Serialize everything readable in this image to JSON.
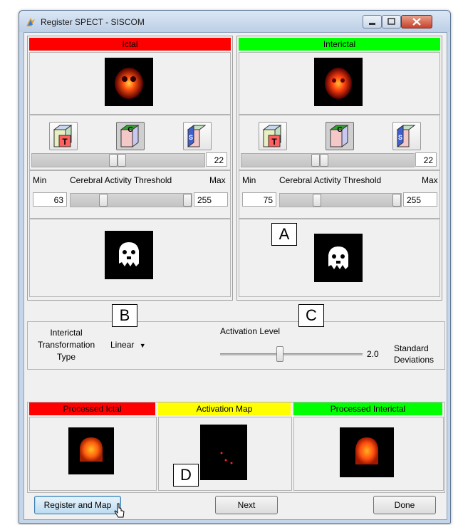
{
  "window": {
    "title": "Register SPECT - SISCOM"
  },
  "ictal_panel": {
    "header": "Ictal",
    "header_color": "#ff0000",
    "slice_value": "22",
    "threshold": {
      "min_label": "Min",
      "title": "Cerebral Activity Threshold",
      "max_label": "Max",
      "min_value": "63",
      "max_value": "255"
    }
  },
  "interictal_panel": {
    "header": "Interictal",
    "header_color": "#00ff00",
    "slice_value": "22",
    "threshold": {
      "min_label": "Min",
      "title": "Cerebral Activity Threshold",
      "max_label": "Max",
      "min_value": "75",
      "max_value": "255"
    }
  },
  "view_buttons": [
    {
      "label": "T",
      "icon": "transverse-cube-icon"
    },
    {
      "label": "C",
      "icon": "coronal-cube-icon",
      "active": true
    },
    {
      "label": "S",
      "icon": "sagittal-cube-icon"
    }
  ],
  "settings": {
    "transformation_label_line1": "Interictal",
    "transformation_label_line2": "Transformation",
    "transformation_label_line3": "Type",
    "transformation_value": "Linear",
    "activation_label": "Activation Level",
    "activation_value": "2.0",
    "units_line1": "Standard",
    "units_line2": "Deviations",
    "activation_fraction": 0.42
  },
  "results": {
    "processed_ictal": {
      "label": "Processed Ictal",
      "color": "#ff0000"
    },
    "activation_map": {
      "label": "Activation Map",
      "color": "#ffff00"
    },
    "processed_interictal": {
      "label": "Processed Interictal",
      "color": "#00ff00"
    }
  },
  "buttons": {
    "register_and_map": "Register and Map",
    "next": "Next",
    "done": "Done"
  },
  "callouts": {
    "a": "A",
    "b": "B",
    "c": "C",
    "d": "D"
  }
}
